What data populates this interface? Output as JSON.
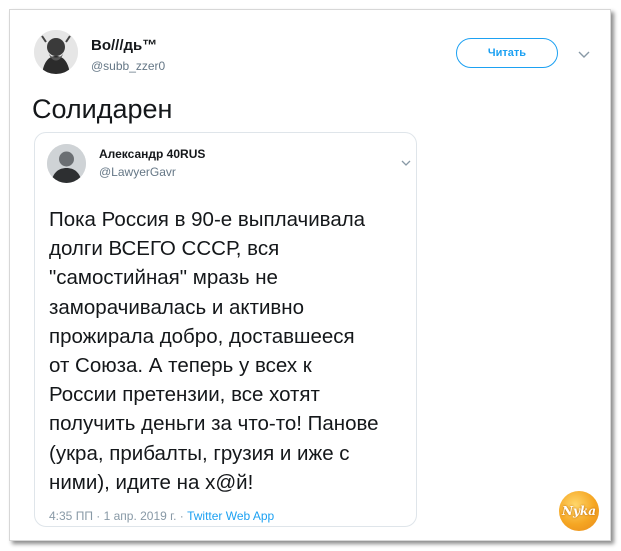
{
  "tweet": {
    "author": {
      "name": "Во///дь™",
      "handle": "@subb_zzer0",
      "avatar_icon": "bearded-portrait-avatar"
    },
    "follow_button_label": "Читать",
    "menu_icon": "chevron-down-icon",
    "text": "Солидарен"
  },
  "quoted_tweet": {
    "author": {
      "name": "Александр 40RUS",
      "handle": "@LawyerGavr",
      "avatar_icon": "person-avatar"
    },
    "menu_icon": "chevron-down-icon",
    "text": "Пока Россия в 90-е выплачивала\nдолги ВСЕГО СССР, вся\n\"самостийная\" мразь не\nзаморачивалась и активно\nпрожирала добро, доставшееся\nот Союза. А теперь у всех к\nРоссии претензии, все хотят\nполучить деньги за что-то! Панове\n(укра, прибалты, грузия и иже с\nними), идите на х@й!",
    "timestamp": "4:35 ПП · 1 апр. 2019 г.",
    "separator": " · ",
    "source": "Twitter Web App"
  },
  "watermark": {
    "text": "Nyka",
    "icon": "nyka-logo-badge"
  },
  "colors": {
    "accent": "#1da1f2",
    "secondary_text": "#657786",
    "border": "#dfe5ea"
  }
}
